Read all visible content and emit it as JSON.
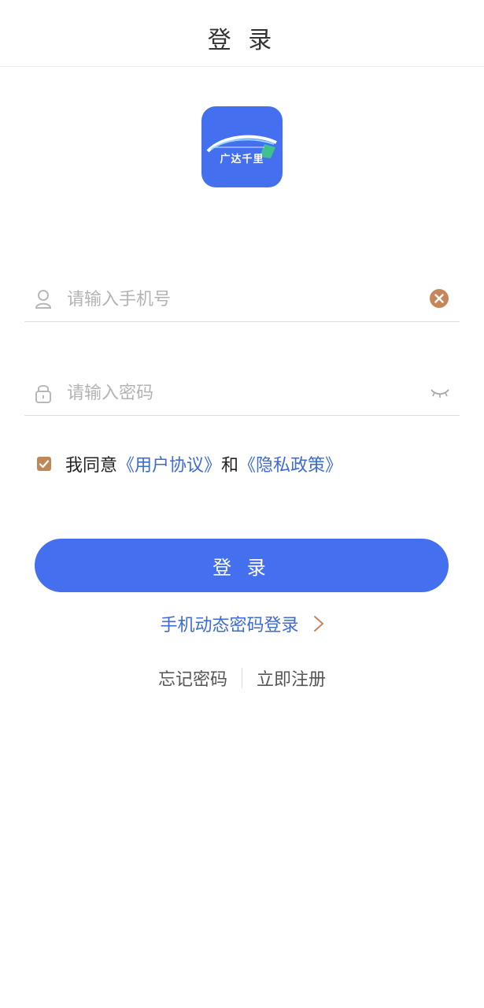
{
  "header": {
    "title": "登 录"
  },
  "logo": {
    "text": "广达千里",
    "icon": "app-logo-icon",
    "bg_color": "#4470f0"
  },
  "phone_field": {
    "placeholder": "请输入手机号",
    "value": "",
    "icon": "user-icon",
    "action_icon": "clear-icon"
  },
  "password_field": {
    "placeholder": "请输入密码",
    "value": "",
    "icon": "lock-icon",
    "action_icon": "eye-closed-icon"
  },
  "agreement": {
    "checked": true,
    "prefix": "我同意",
    "user_agreement": "《用户协议》",
    "conjunction": "和",
    "privacy_policy": "《隐私政策》"
  },
  "login_button": {
    "label": "登 录"
  },
  "sms_login": {
    "label": "手机动态密码登录",
    "icon": "chevron-right-icon"
  },
  "links": {
    "forgot_password": "忘记密码",
    "register": "立即注册"
  },
  "colors": {
    "primary": "#4470f0",
    "link": "#3c6bd6",
    "accent": "#c08858"
  }
}
